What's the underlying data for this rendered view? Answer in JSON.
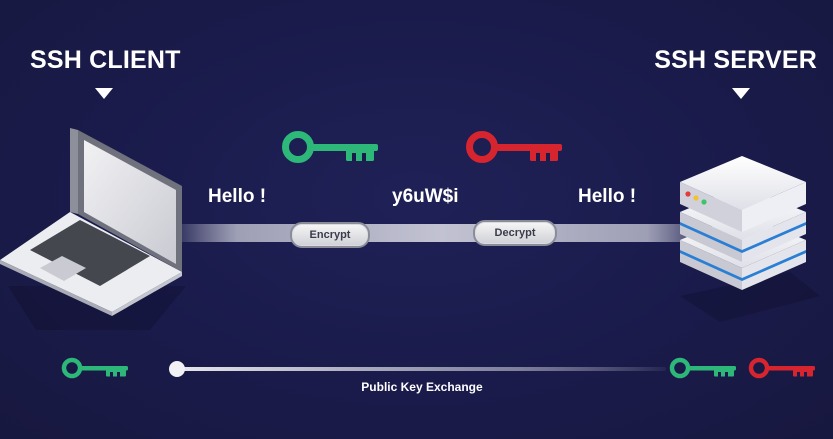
{
  "client": {
    "title": "SSH CLIENT"
  },
  "server": {
    "title": "SSH SERVER"
  },
  "flow": {
    "plaintext_left": "Hello !",
    "ciphertext": "y6uW$i",
    "plaintext_right": "Hello !",
    "encrypt_label": "Encrypt",
    "decrypt_label": "Decrypt"
  },
  "exchange": {
    "label": "Public Key Exchange"
  },
  "colors": {
    "background": "#1a1b4b",
    "public_key": "#2db87a",
    "private_key": "#d6252f",
    "server_stripe": "#2a7fd4"
  },
  "icons": {
    "client": "laptop-icon",
    "server": "server-stack-icon",
    "public_key": "green-key-icon",
    "private_key": "red-key-icon"
  }
}
